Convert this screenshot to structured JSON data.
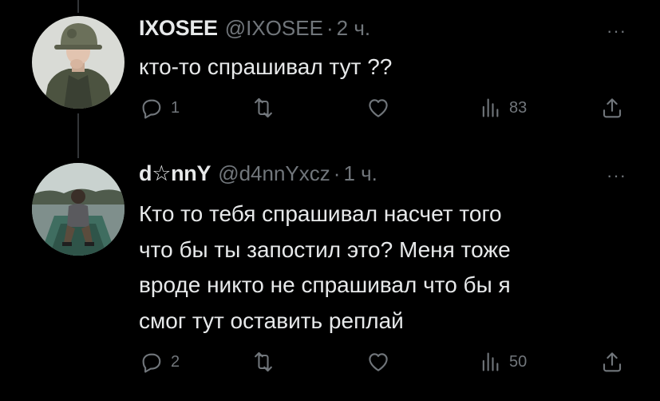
{
  "tweets": [
    {
      "name": "IXOSEE",
      "handle": "@IXOSEE",
      "separator": "·",
      "time": "2 ч.",
      "text_lines": [
        "кто-то спрашивал тут ??"
      ],
      "more": "···",
      "actions": {
        "reply_count": "1",
        "retweet_count": "",
        "like_count": "",
        "views_count": "83"
      },
      "avatar_icon": "soldier-avatar"
    },
    {
      "name": "d☆nnY",
      "handle": "@d4nnYxcz",
      "separator": "·",
      "time": "1 ч.",
      "text_lines": [
        "Кто то тебя спрашивал насчет того",
        "что бы ты запостил это? Меня тоже",
        "вроде никто не спрашивал что бы я",
        "смог тут оставить реплай"
      ],
      "more": "···",
      "actions": {
        "reply_count": "2",
        "retweet_count": "",
        "like_count": "",
        "views_count": "50"
      },
      "avatar_icon": "boat-lake-avatar"
    }
  ],
  "colors": {
    "background": "#000000",
    "text_primary": "#e7e9ea",
    "text_secondary": "#71767b",
    "thread_line": "#333639"
  }
}
